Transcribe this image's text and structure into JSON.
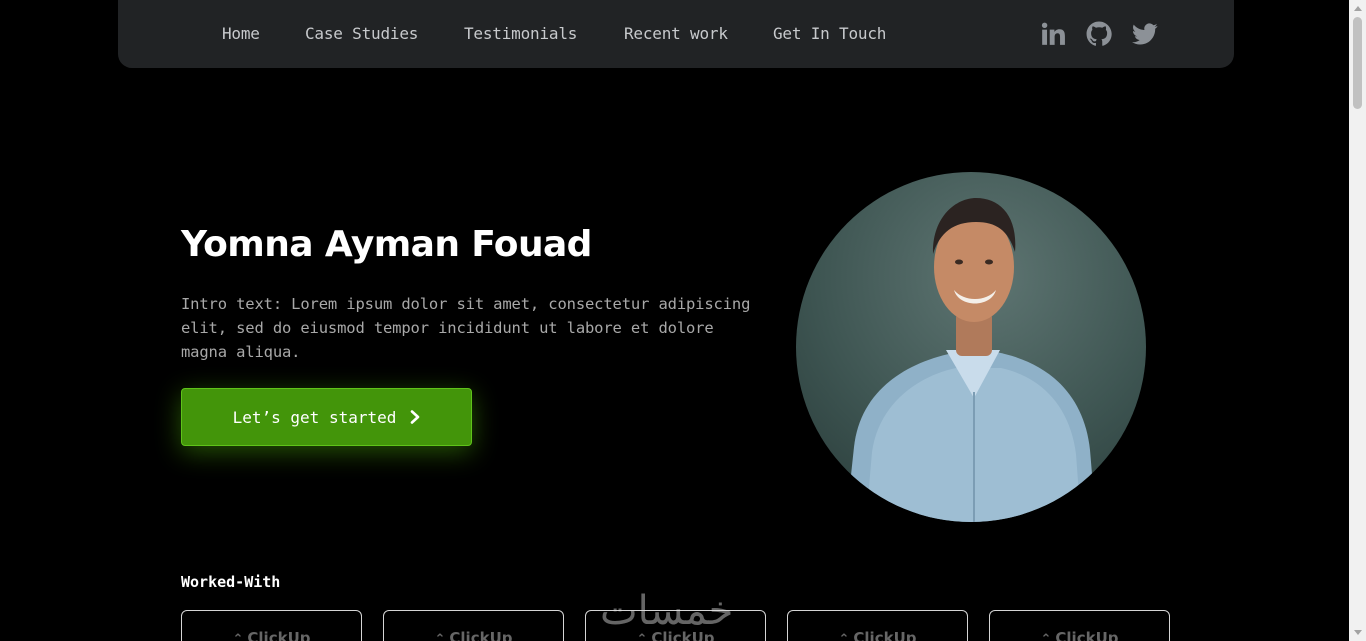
{
  "nav": {
    "links": [
      "Home",
      "Case Studies",
      "Testimonials",
      "Recent work",
      "Get In Touch"
    ],
    "social_icons": [
      "linkedin-icon",
      "github-icon",
      "twitter-icon"
    ]
  },
  "hero": {
    "name": "Yomna Ayman Fouad",
    "intro": "Intro text: Lorem ipsum dolor sit amet, consectetur adipiscing elit, sed do eiusmod tempor incididunt ut labore et dolore magna aliqua.",
    "cta_label": "Let’s get started",
    "cta_icon": "chevron-right-icon"
  },
  "worked_with": {
    "title": "Worked-With",
    "logos": [
      "ClickUp",
      "ClickUp",
      "ClickUp",
      "ClickUp",
      "ClickUp"
    ]
  },
  "watermark": "خمسات",
  "colors": {
    "background": "#000000",
    "navbar": "#212325",
    "accent_green": "#43950a",
    "nav_text": "#c7c9cc",
    "icon_gray": "#8c9197"
  }
}
